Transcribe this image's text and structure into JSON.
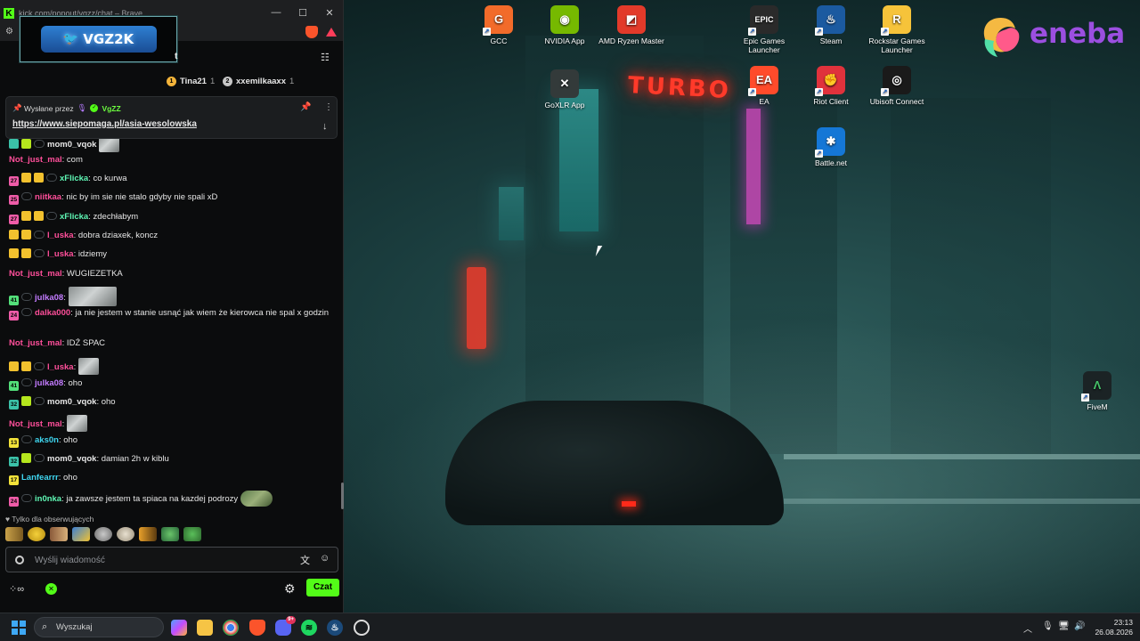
{
  "browser": {
    "window_title": "kick.com/popout/vgzz/chat – Brave",
    "stream_badge": "VGZ2K",
    "window_controls": {
      "minimize": "—",
      "maximize": "☐",
      "close": "✕"
    }
  },
  "chat": {
    "header_title": "t",
    "leaderboard": [
      {
        "name": "Tina21",
        "count": "1",
        "medal_color": "#f4b43a",
        "medal": "1"
      },
      {
        "name": "xxemilkaaxx",
        "count": "1",
        "medal_color": "#c7c7c7",
        "medal": "2"
      }
    ],
    "pinned": {
      "label": "Wysłane przez",
      "sender": "VgZZ",
      "link": "https://www.siepomaga.pl/asia-wesolowska"
    },
    "messages": [
      {
        "badges": [
          {
            "t": "",
            "c": "#3bc1a8"
          },
          {
            "t": "",
            "c": "#b5e61d"
          }
        ],
        "ring": true,
        "user": "mom0_vqok",
        "color": "#e8e8e8",
        "text": "",
        "emote": "normal"
      },
      {
        "badges": [],
        "ring": false,
        "user": "Not_just_mal",
        "color": "#ff4f9a",
        "text": ": com",
        "emote": ""
      },
      {
        "badges": [
          {
            "t": "27",
            "c": "#ef5ca8"
          },
          {
            "t": "",
            "c": "#f2c12e"
          },
          {
            "t": "",
            "c": "#f2c12e"
          }
        ],
        "ring": true,
        "user": "xFlicka",
        "color": "#5ff7b5",
        "text": ": co kurwa",
        "emote": ""
      },
      {
        "badges": [
          {
            "t": "25",
            "c": "#ef5ca8"
          }
        ],
        "ring": true,
        "user": "niitkaa",
        "color": "#ff4f9a",
        "text": ": nic by im sie nie stalo gdyby nie spali xD",
        "emote": ""
      },
      {
        "badges": [
          {
            "t": "27",
            "c": "#ef5ca8"
          },
          {
            "t": "",
            "c": "#f2c12e"
          },
          {
            "t": "",
            "c": "#f2c12e"
          }
        ],
        "ring": true,
        "user": "xFlicka",
        "color": "#5ff7b5",
        "text": ": zdechłabym",
        "emote": ""
      },
      {
        "badges": [
          {
            "t": "",
            "c": "#f2c12e"
          },
          {
            "t": "",
            "c": "#f2c12e"
          }
        ],
        "ring": true,
        "user": "l_uska",
        "color": "#ff4f9a",
        "text": ": dobra dziaxek, koncz",
        "emote": ""
      },
      {
        "badges": [
          {
            "t": "",
            "c": "#f2c12e"
          },
          {
            "t": "",
            "c": "#f2c12e"
          }
        ],
        "ring": true,
        "user": "l_uska",
        "color": "#ff4f9a",
        "text": ": idziemy",
        "emote": ""
      },
      {
        "badges": [],
        "ring": false,
        "user": "Not_just_mal",
        "color": "#ff4f9a",
        "text": ": WUGIEZETKA",
        "emote": ""
      },
      {
        "badges": [
          {
            "t": "41",
            "c": "#53e07a"
          }
        ],
        "ring": true,
        "user": "julka08",
        "color": "#c37cff",
        "text": ":",
        "emote": "wide"
      },
      {
        "badges": [
          {
            "t": "24",
            "c": "#ef5ca8"
          }
        ],
        "ring": true,
        "user": "dalka000",
        "color": "#ff4f9a",
        "text": ": ja nie jestem w stanie usnąć jak wiem że kierowca nie spal x godzin",
        "emote": ""
      },
      {
        "badges": [],
        "ring": false,
        "user": "Not_just_mal",
        "color": "#ff4f9a",
        "text": ": IDŹ SPAC",
        "emote": ""
      },
      {
        "badges": [
          {
            "t": "",
            "c": "#f2c12e"
          },
          {
            "t": "",
            "c": "#f2c12e"
          }
        ],
        "ring": true,
        "user": "l_uska",
        "color": "#ff4f9a",
        "text": ":",
        "emote": "normal"
      },
      {
        "badges": [
          {
            "t": "41",
            "c": "#53e07a"
          }
        ],
        "ring": true,
        "user": "julka08",
        "color": "#c37cff",
        "text": ": oho",
        "emote": ""
      },
      {
        "badges": [
          {
            "t": "32",
            "c": "#3bc1a8"
          },
          {
            "t": "",
            "c": "#b5e61d"
          }
        ],
        "ring": true,
        "user": "mom0_vqok",
        "color": "#e8e8e8",
        "text": ": oho",
        "emote": ""
      },
      {
        "badges": [],
        "ring": false,
        "user": "Not_just_mal",
        "color": "#ff4f9a",
        "text": ":",
        "emote": "normal"
      },
      {
        "badges": [
          {
            "t": "13",
            "c": "#f2e23a"
          }
        ],
        "ring": true,
        "user": "aks0n",
        "color": "#3fd6f0",
        "text": ": oho",
        "emote": ""
      },
      {
        "badges": [
          {
            "t": "32",
            "c": "#3bc1a8"
          },
          {
            "t": "",
            "c": "#b5e61d"
          }
        ],
        "ring": true,
        "user": "mom0_vqok",
        "color": "#e8e8e8",
        "text": ": damian 2h w kiblu",
        "emote": ""
      },
      {
        "badges": [
          {
            "t": "17",
            "c": "#f2e23a"
          }
        ],
        "ring": false,
        "user": "Lanfearrr",
        "color": "#3fd6f0",
        "text": ": oho",
        "emote": ""
      },
      {
        "badges": [
          {
            "t": "24",
            "c": "#ef5ca8"
          }
        ],
        "ring": true,
        "user": "in0nka",
        "color": "#5ff7b5",
        "text": ": ja zawsze jestem ta spiaca na kazdej podrozy",
        "emote": "frog"
      }
    ],
    "followers_only": "Tylko dla obserwujących",
    "input_placeholder": "Wyślij wiadomość",
    "send_label": "Czat"
  },
  "desktop": {
    "icons": [
      {
        "label": "GCC",
        "color": "#f26b2a",
        "glyph": "G"
      },
      {
        "label": "NVIDIA App",
        "color": "#76b900",
        "glyph": "◉"
      },
      {
        "label": "AMD Ryzen Master",
        "color": "#e23a2a",
        "glyph": "◩"
      },
      {
        "label": "Epic Games Launcher",
        "color": "#2a2a2a",
        "glyph": "EPIC"
      },
      {
        "label": "Steam",
        "color": "#1b5aa0",
        "glyph": "♨"
      },
      {
        "label": "Rockstar Games Launcher",
        "color": "#f6c33a",
        "glyph": "R"
      },
      {
        "label": "GoXLR App",
        "color": "#333a3a",
        "glyph": "✕"
      },
      {
        "label": "EA",
        "color": "#ff4b2b",
        "glyph": "EA"
      },
      {
        "label": "Riot Client",
        "color": "#e0323c",
        "glyph": "✊"
      },
      {
        "label": "Ubisoft Connect",
        "color": "#1a1a1a",
        "glyph": "◎"
      },
      {
        "label": "Battle.net",
        "color": "#1577d6",
        "glyph": "✱"
      },
      {
        "label": "FiveM",
        "color": "#1b2325",
        "glyph": "Λ"
      }
    ],
    "brand": "eneba"
  },
  "taskbar": {
    "search_placeholder": "Wyszukaj",
    "time": "23:13",
    "date": "26.08.2026",
    "discord_badge": "9+"
  }
}
